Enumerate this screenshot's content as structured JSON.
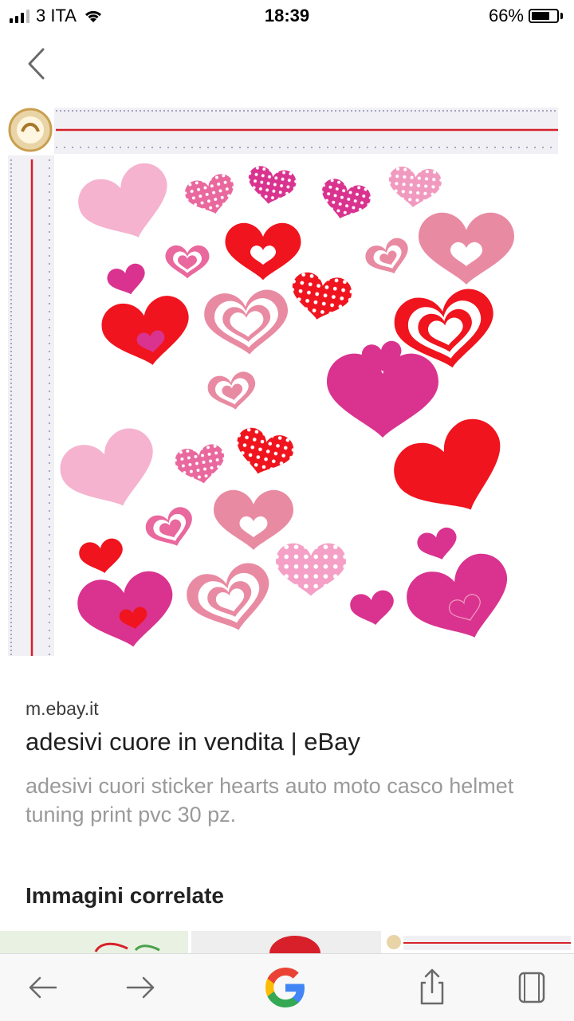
{
  "status_bar": {
    "carrier": "3 ITA",
    "time": "18:39",
    "battery_percent_label": "66%",
    "battery_level": 0.66,
    "signal_bars_active": 3,
    "signal_bars_total": 4
  },
  "nav": {
    "back_icon": "chevron-left-icon"
  },
  "result": {
    "source_domain": "m.ebay.it",
    "title": "adesivi cuore in vendita | eBay",
    "description": "adesivi cuori sticker hearts auto moto casco helmet tuning print pvc 30 pz."
  },
  "related": {
    "heading": "Immagini correlate"
  },
  "bottom_bar": {
    "back_icon": "arrow-left-icon",
    "forward_icon": "arrow-right-icon",
    "home_icon": "google-logo-icon",
    "share_icon": "share-icon",
    "tabs_icon": "tabs-icon"
  },
  "colors": {
    "heart_red": "#f0141e",
    "heart_pink_light": "#f5b3cf",
    "heart_magenta": "#d9338f",
    "heart_rose": "#e98aa3",
    "ruler_red": "#d7202a"
  }
}
